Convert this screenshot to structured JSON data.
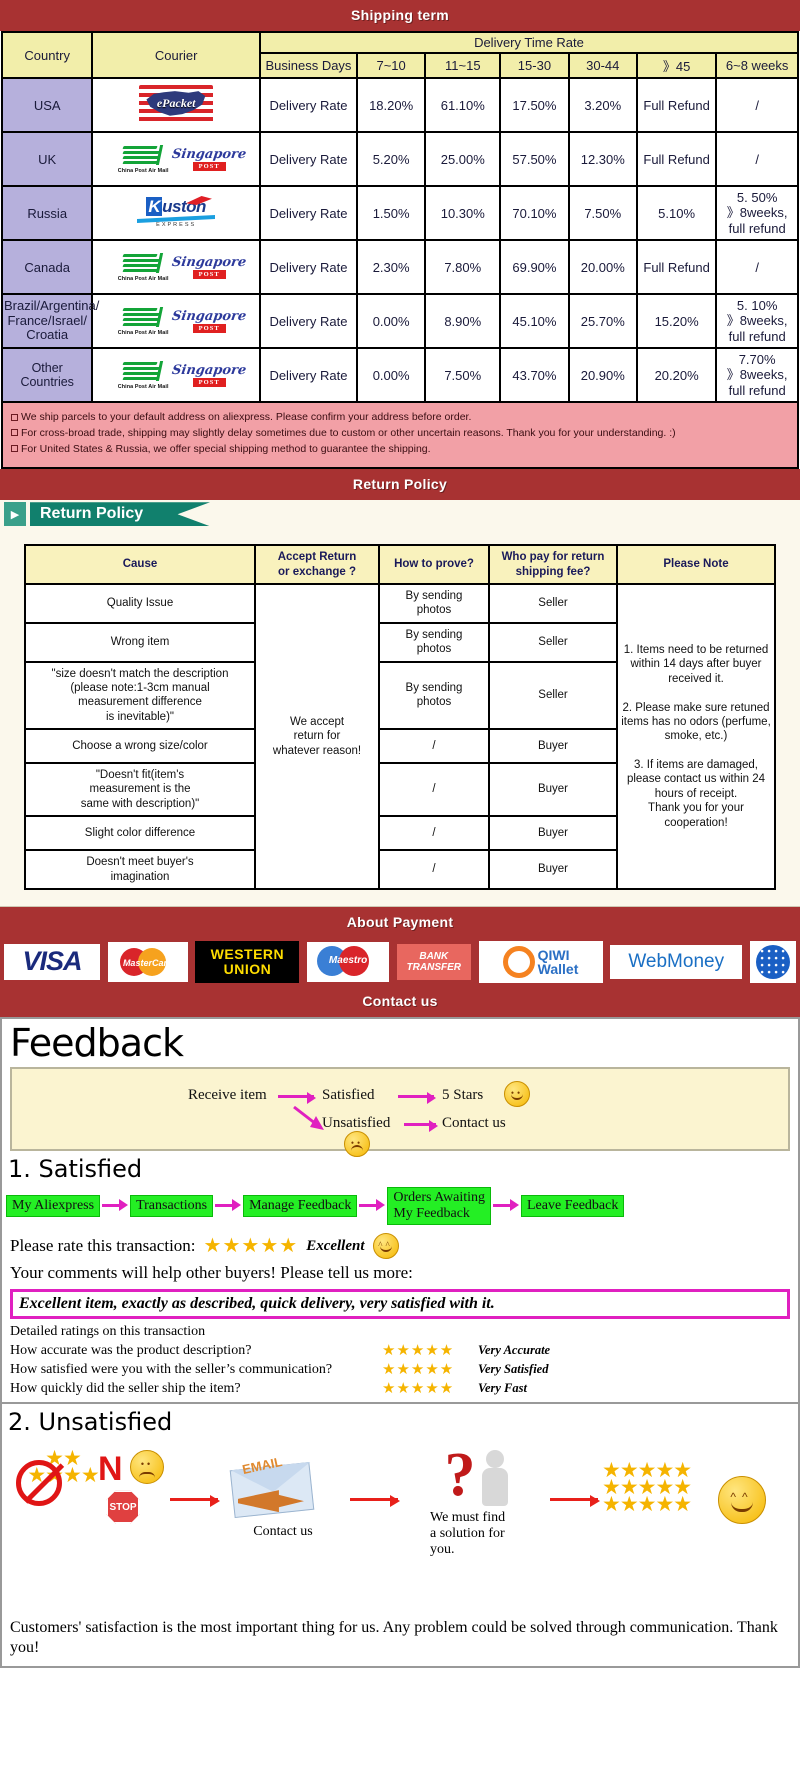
{
  "banners": {
    "shipping": "Shipping term",
    "return": "Return Policy",
    "payment": "About Payment",
    "contact": "Contact us"
  },
  "shipping_table": {
    "headers": {
      "country": "Country",
      "courier": "Courier",
      "delivery_time_rate": "Delivery Time Rate",
      "business_days": "Business Days",
      "ranges": [
        "7~10",
        "11~15",
        "15-30",
        "30-44",
        "》45",
        "6~8 weeks"
      ]
    },
    "rows": [
      {
        "country": "USA",
        "couriers": [
          "epacket-logo"
        ],
        "label": "Delivery Rate",
        "values": [
          "18.20%",
          "61.10%",
          "17.50%",
          "3.20%"
        ],
        "over45": "Full Refund",
        "weeks": "/"
      },
      {
        "country": "UK",
        "couriers": [
          "china-post-air-mail-logo",
          "singapore-post-logo"
        ],
        "label": "Delivery Rate",
        "values": [
          "5.20%",
          "25.00%",
          "57.50%",
          "12.30%"
        ],
        "over45": "Full Refund",
        "weeks": "/"
      },
      {
        "country": "Russia",
        "couriers": [
          "ruston-express-logo"
        ],
        "label": "Delivery Rate",
        "values": [
          "1.50%",
          "10.30%",
          "70.10%",
          "7.50%"
        ],
        "over45": "5.10%",
        "weeks": "5. 50%\n》8weeks,\nfull refund"
      },
      {
        "country": "Canada",
        "couriers": [
          "china-post-air-mail-logo",
          "singapore-post-logo"
        ],
        "label": "Delivery Rate",
        "values": [
          "2.30%",
          "7.80%",
          "69.90%",
          "20.00%"
        ],
        "over45": "Full Refund",
        "weeks": "/"
      },
      {
        "country": "Brazil/Argentina/\nFrance/Israel/\nCroatia",
        "couriers": [
          "china-post-air-mail-logo",
          "singapore-post-logo"
        ],
        "label": "Delivery Rate",
        "values": [
          "0.00%",
          "8.90%",
          "45.10%",
          "25.70%"
        ],
        "over45": "15.20%",
        "weeks": "5. 10%\n》8weeks,\nfull refund"
      },
      {
        "country": "Other Countries",
        "couriers": [
          "china-post-air-mail-logo",
          "singapore-post-logo"
        ],
        "label": "Delivery Rate",
        "values": [
          "0.00%",
          "7.50%",
          "43.70%",
          "20.90%"
        ],
        "over45": "20.20%",
        "weeks": "7.70%\n》8weeks,\nfull refund"
      }
    ]
  },
  "shipping_notes": [
    "We ship parcels to your default address on aliexpress. Please confirm your address before order.",
    "For cross-broad trade, shipping may slightly delay sometimes due to custom or other uncertain reasons. Thank you for your understanding. :)",
    "For United States & Russia, we offer special shipping method to guarantee the shipping."
  ],
  "return_policy": {
    "flag_label": "Return Policy",
    "headers": [
      "Cause",
      "Accept Return\nor exchange ?",
      "How to prove?",
      "Who pay for return\nshipping fee?",
      "Please Note"
    ],
    "accept_text": "We accept\nreturn for\nwhatever reason!",
    "rows": [
      {
        "cause": "Quality Issue",
        "prove": "By sending\nphotos",
        "who": "Seller"
      },
      {
        "cause": "Wrong item",
        "prove": "By sending\nphotos",
        "who": "Seller"
      },
      {
        "cause": "\"size doesn't match the description\n(please note:1-3cm manual\nmeasurement difference\nis inevitable)\"",
        "prove": "By sending\nphotos",
        "who": "Seller"
      },
      {
        "cause": "Choose a wrong size/color",
        "prove": "/",
        "who": "Buyer"
      },
      {
        "cause": "\"Doesn't fit(item's\nmeasurement is the\nsame with description)\"",
        "prove": "/",
        "who": "Buyer"
      },
      {
        "cause": "Slight color difference",
        "prove": "/",
        "who": "Buyer"
      },
      {
        "cause": "Doesn't meet buyer's\nimagination",
        "prove": "/",
        "who": "Buyer"
      }
    ],
    "note": "1. Items need to be returned within 14 days after buyer received it.\n\n2. Please make sure retuned items has no odors (perfume, smoke, etc.)\n\n3. If items are damaged, please contact us within 24 hours of receipt.\nThank you for your cooperation!"
  },
  "payment_methods": [
    {
      "name": "visa-logo",
      "label": "VISA"
    },
    {
      "name": "mastercard-logo",
      "label": "MasterCard"
    },
    {
      "name": "western-union-logo",
      "label1": "WESTERN",
      "label2": "UNION"
    },
    {
      "name": "maestro-logo",
      "label": "Maestro"
    },
    {
      "name": "bank-transfer-logo",
      "label1": "BANK",
      "label2": "TRANSFER"
    },
    {
      "name": "qiwi-wallet-logo",
      "label1": "QIWI",
      "label2": "Wallet"
    },
    {
      "name": "webmoney-logo",
      "label": "WebMoney"
    },
    {
      "name": "globe-logo",
      "label": ""
    }
  ],
  "feedback": {
    "title": "Feedback",
    "flow": {
      "receive": "Receive item",
      "satisfied": "Satisfied",
      "five_stars": "5 Stars",
      "unsatisfied": "Unsatisfied",
      "contact": "Contact us"
    },
    "satisfied": {
      "heading": "1. Satisfied",
      "steps": [
        "My Aliexpress",
        "Transactions",
        "Manage Feedback",
        "Orders Awaiting\nMy Feedback",
        "Leave Feedback"
      ],
      "rate_prompt": "Please rate this transaction:",
      "stars": "★★★★★",
      "rate_value": "Excellent",
      "comment_prompt": "Your comments will help other buyers! Please tell us more:",
      "comment_text": "Excellent item, exactly as described, quick delivery, very satisfied with it.",
      "detail_heading": "Detailed ratings on this transaction",
      "details": [
        {
          "question": "How accurate was the product description?",
          "stars": "★★★★★",
          "value": "Very Accurate"
        },
        {
          "question": "How satisfied were you with the seller’s communication?",
          "stars": "★★★★★",
          "value": "Very Satisfied"
        },
        {
          "question": "How quickly did the seller ship the item?",
          "stars": "★★★★★",
          "value": "Very Fast"
        }
      ]
    },
    "unsatisfied": {
      "heading": "2. Unsatisfied",
      "no_label": "N",
      "stop_label": "STOP",
      "email_label": "EMAIL",
      "contact_label": "Contact us",
      "solution_label": "We must find\na solution for\nyou.",
      "closing": "Customers' satisfaction is the most important thing for us. Any problem could be solved through communication. Thank you!"
    }
  },
  "colors": {
    "banner_red": "#a83232",
    "header_yellow": "#f2eeaa",
    "country_purple": "#b6b0dc",
    "note_pink": "#f2a0a6",
    "flag_teal": "#11806d",
    "step_green": "#24ef24",
    "magenta": "#e020c0",
    "star_gold": "#f5b400"
  }
}
